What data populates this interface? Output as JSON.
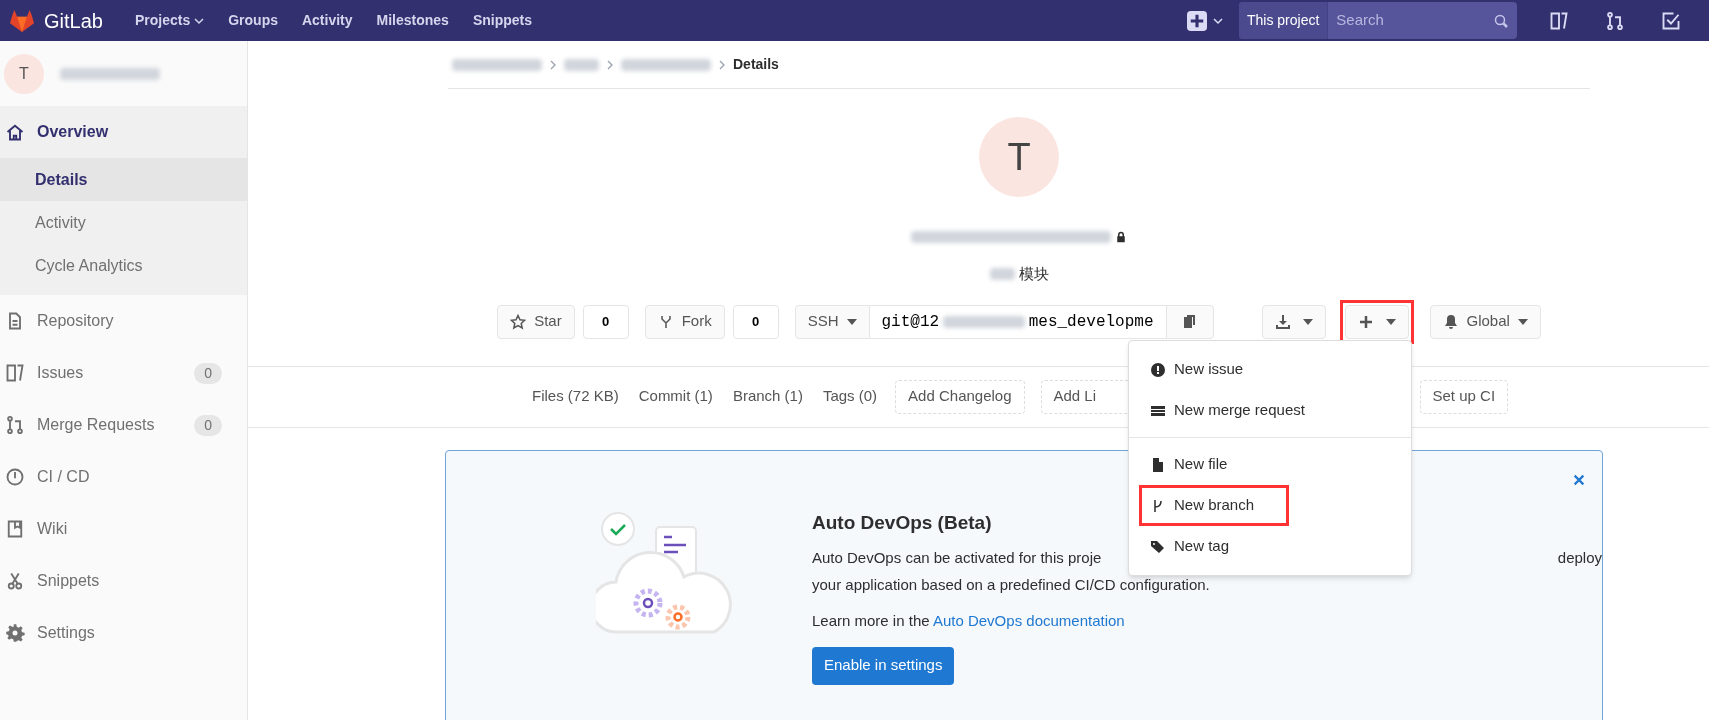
{
  "navbar": {
    "brand": "GitLab",
    "links": [
      {
        "label": "Projects",
        "dropdown": true
      },
      {
        "label": "Groups",
        "dropdown": false
      },
      {
        "label": "Activity",
        "dropdown": false
      },
      {
        "label": "Milestones",
        "dropdown": false
      },
      {
        "label": "Snippets",
        "dropdown": false
      }
    ],
    "scope": "This project",
    "search": {
      "placeholder": "Search"
    }
  },
  "sidebar": {
    "project_initial": "T",
    "items": [
      {
        "label": "Overview",
        "selected": true,
        "children": [
          {
            "label": "Details",
            "selected": true
          },
          {
            "label": "Activity",
            "selected": false
          },
          {
            "label": "Cycle Analytics",
            "selected": false
          }
        ]
      },
      {
        "label": "Repository",
        "selected": false
      },
      {
        "label": "Issues",
        "selected": false,
        "count": "0"
      },
      {
        "label": "Merge Requests",
        "selected": false,
        "count": "0"
      },
      {
        "label": "CI / CD",
        "selected": false
      },
      {
        "label": "Wiki",
        "selected": false
      },
      {
        "label": "Snippets",
        "selected": false
      },
      {
        "label": "Settings",
        "selected": false
      }
    ]
  },
  "breadcrumb": {
    "current": "Details"
  },
  "project": {
    "initial": "T",
    "private": true,
    "description": "模块"
  },
  "actions": {
    "star": {
      "label": "Star",
      "count": "0"
    },
    "fork": {
      "label": "Fork",
      "count": "0"
    },
    "clone": {
      "protocol": "SSH",
      "url_start": "git@12",
      "url_end": "mes_developme"
    },
    "notification": "Global"
  },
  "stats": [
    {
      "label": "Files (72 KB)",
      "kind": "link"
    },
    {
      "label": "Commit (1)",
      "kind": "link"
    },
    {
      "label": "Branch (1)",
      "kind": "link"
    },
    {
      "label": "Tags (0)",
      "kind": "link"
    },
    {
      "label": "Add Changelog",
      "kind": "dashed"
    },
    {
      "label": "Add Li",
      "kind": "dashed"
    },
    {
      "label": "Set up CI",
      "kind": "dashed"
    }
  ],
  "banner": {
    "title": "Auto DevOps (Beta)",
    "text_start": "Auto DevOps can be activated for this proje",
    "text_end": "deploy",
    "text_line2": "your application based on a predefined CI/CD configuration.",
    "learn": "Learn more in the",
    "link": "Auto DevOps documentation",
    "button": "Enable in settings"
  },
  "menu": {
    "items": [
      {
        "kind": "item",
        "label": "New issue",
        "highlighted": false
      },
      {
        "kind": "item",
        "label": "New merge request",
        "highlighted": false
      },
      {
        "kind": "divider"
      },
      {
        "kind": "item",
        "label": "New file",
        "highlighted": false
      },
      {
        "kind": "item",
        "label": "New branch",
        "highlighted": true
      },
      {
        "kind": "item",
        "label": "New tag",
        "highlighted": false
      }
    ]
  },
  "new_button_highlighted": true
}
